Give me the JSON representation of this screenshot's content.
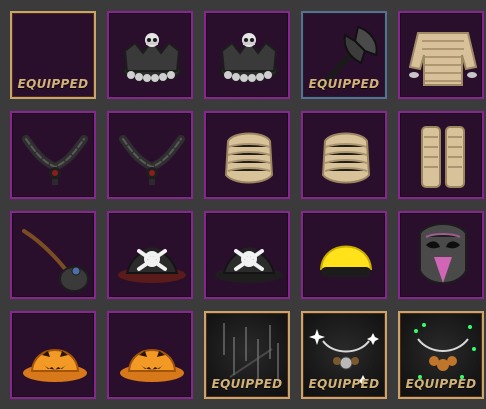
{
  "inventory": {
    "equipped_label": "EQUIPPED",
    "items": [
      {
        "icon": "empty-slot-icon",
        "equipped": true
      },
      {
        "icon": "crown-skull-icon",
        "equipped": false
      },
      {
        "icon": "crown-skull-icon",
        "equipped": false
      },
      {
        "icon": "axe-icon",
        "equipped": true
      },
      {
        "icon": "mummy-shirt-icon",
        "equipped": false
      },
      {
        "icon": "chain-necklace-icon",
        "equipped": false
      },
      {
        "icon": "chain-necklace-icon",
        "equipped": false
      },
      {
        "icon": "bandage-wrap-icon",
        "equipped": false
      },
      {
        "icon": "bandage-wrap-icon",
        "equipped": false
      },
      {
        "icon": "bandage-legs-icon",
        "equipped": false
      },
      {
        "icon": "satchel-bag-icon",
        "equipped": false
      },
      {
        "icon": "pirate-hat-icon",
        "equipped": false
      },
      {
        "icon": "pirate-hat-icon",
        "equipped": false
      },
      {
        "icon": "yellow-beanie-icon",
        "equipped": false
      },
      {
        "icon": "mask-helmet-icon",
        "equipped": false
      },
      {
        "icon": "pumpkin-hat-icon",
        "equipped": false
      },
      {
        "icon": "pumpkin-hat-icon",
        "equipped": false
      },
      {
        "icon": "rain-effect-icon",
        "equipped": true
      },
      {
        "icon": "sparkle-necklace-icon",
        "equipped": true
      },
      {
        "icon": "green-sparkle-necklace-icon",
        "equipped": true
      }
    ]
  }
}
